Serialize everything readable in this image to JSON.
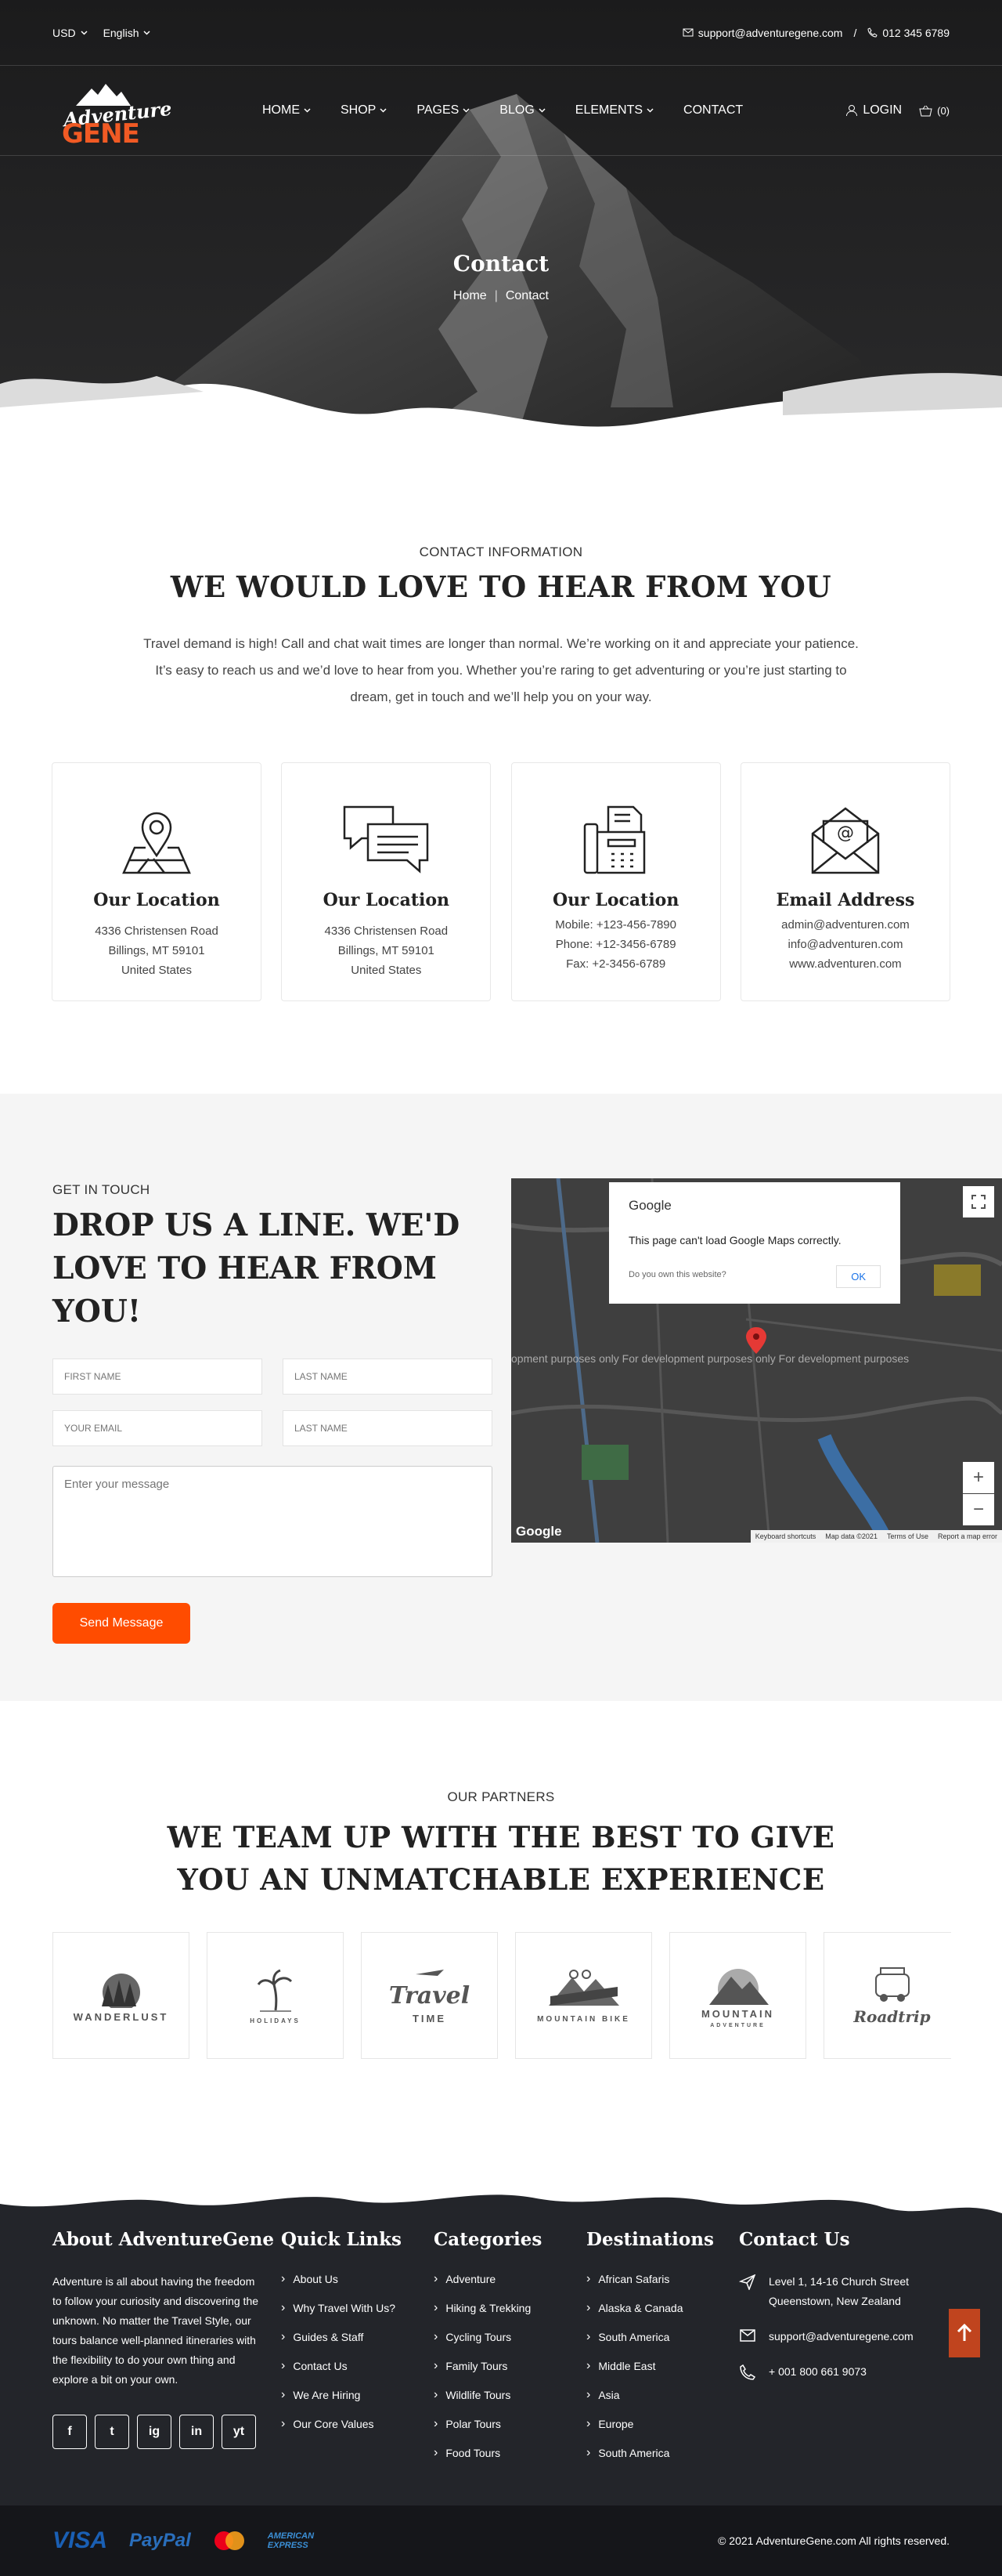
{
  "topbar": {
    "currency": "USD",
    "language": "English",
    "email": "support@adventuregene.com",
    "separator": "/",
    "phone": "012 345 6789"
  },
  "logo": {
    "line1": "Adventure",
    "line2": "GENE"
  },
  "nav": {
    "items": [
      {
        "label": "HOME",
        "dropdown": true
      },
      {
        "label": "SHOP",
        "dropdown": true
      },
      {
        "label": "PAGES",
        "dropdown": true
      },
      {
        "label": "BLOG",
        "dropdown": true
      },
      {
        "label": "ELEMENTS",
        "dropdown": true
      },
      {
        "label": "CONTACT",
        "dropdown": false
      }
    ],
    "login": "LOGIN",
    "cart": "(0)"
  },
  "hero": {
    "title": "Contact",
    "crumb_home": "Home",
    "crumb_sep": "|",
    "crumb_current": "Contact"
  },
  "info": {
    "eyebrow": "CONTACT INFORMATION",
    "title": "WE WOULD LOVE TO HEAR FROM YOU",
    "lead": "Travel demand is high! Call and chat wait times are longer than normal. We’re working on it and appreciate your patience. It’s easy to reach us and we’d love to hear from you. Whether you’re raring to get adventuring or you’re just starting to dream, get in touch and we’ll help you on your way.",
    "cards": [
      {
        "icon": "map-pin-icon",
        "title": "Our Location",
        "lines": [
          "4336 Christensen Road",
          "Billings, MT 59101",
          "United States"
        ]
      },
      {
        "icon": "chat-bubbles-icon",
        "title": "Our Location",
        "lines": [
          "4336 Christensen Road",
          "Billings, MT 59101",
          "United States"
        ]
      },
      {
        "icon": "fax-icon",
        "title": "Our Location",
        "lines": [
          "Mobile: +123-456-7890",
          "Phone: +12-3456-6789",
          "Fax: +2-3456-6789"
        ]
      },
      {
        "icon": "envelope-at-icon",
        "title": "Email Address",
        "lines": [
          "admin@adventuren.com",
          "info@adventuren.com",
          "www.adventuren.com"
        ]
      }
    ]
  },
  "touch": {
    "eyebrow": "GET IN TOUCH",
    "title": "DROP US A LINE. WE'D LOVE TO HEAR FROM YOU!",
    "first_name_ph": "FIRST NAME",
    "last_name_ph": "LAST NAME",
    "email_ph": "YOUR EMAIL",
    "last_name2_ph": "LAST NAME",
    "message_ph": "Enter your message",
    "send": "Send Message"
  },
  "map": {
    "brand": "Google",
    "message": "This page can't load Google Maps correctly.",
    "question": "Do you own this website?",
    "ok": "OK",
    "dev_text": "opment purposes only          For development purposes only          For development purposes",
    "footer_items": [
      "Keyboard shortcuts",
      "Map data ©2021",
      "Terms of Use",
      "Report a map error"
    ],
    "logo": "Google",
    "zoom_in": "+",
    "zoom_out": "−"
  },
  "partners": {
    "eyebrow": "OUR PARTNERS",
    "title": "WE TEAM UP WITH THE BEST TO GIVE YOU AN UNMATCHABLE EXPERIENCE",
    "logos": [
      {
        "name": "WANDERLUST",
        "icon": "trees-icon"
      },
      {
        "name": "HOLIDAYS",
        "icon": "palm-tree-icon"
      },
      {
        "name": "Travel",
        "sub": "TIME",
        "icon": "plane-icon"
      },
      {
        "name": "MOUNTAIN BIKE",
        "icon": "bike-icon"
      },
      {
        "name": "MOUNTAIN",
        "sub": "ADVENTURE",
        "icon": "mountain-icon"
      },
      {
        "name": "Roadtrip",
        "icon": "van-icon"
      }
    ]
  },
  "footer": {
    "about_title": "About AdventureGene",
    "about_text": "Adventure is all about having the freedom to follow your curiosity and discovering the unknown. No matter the Travel Style, our tours balance well-planned itineraries with the flexibility to do your own thing and explore a bit on your own.",
    "socials": [
      "f",
      "t",
      "ig",
      "in",
      "yt"
    ],
    "quick_title": "Quick Links",
    "quick": [
      "About Us",
      "Why Travel With Us?",
      "Guides & Staff",
      "Contact Us",
      "We Are Hiring",
      "Our Core Values"
    ],
    "cat_title": "Categories",
    "categories": [
      "Adventure",
      "Hiking & Trekking",
      "Cycling Tours",
      "Family Tours",
      "Wildlife Tours",
      "Polar Tours",
      "Food Tours"
    ],
    "dest_title": "Destinations",
    "destinations": [
      "African Safaris",
      "Alaska & Canada",
      "South America",
      "Middle East",
      "Asia",
      "Europe",
      "South America"
    ],
    "contact_title": "Contact Us",
    "address": "Level 1, 14-16 Church Street Queenstown, New Zealand",
    "email": "support@adventuregene.com",
    "phone": "+ 001 800 661 9073",
    "payments": {
      "visa": "VISA",
      "paypal": "PayPal",
      "amex1": "AMERICAN",
      "amex2": "EXPRESS"
    },
    "copyright": "© 2021 AdventureGene.com All rights reserved."
  },
  "colors": {
    "accent": "#ff4c00",
    "dark": "#23252a",
    "light_bg": "#f5f5f5"
  }
}
